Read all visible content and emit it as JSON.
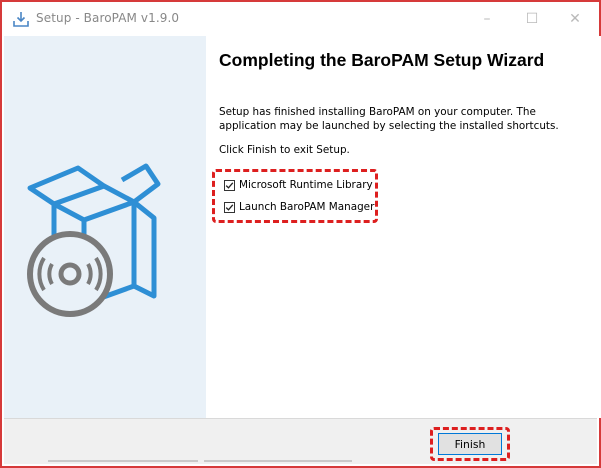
{
  "window": {
    "title": "Setup - BaroPAM v1.9.0",
    "icon": "setup-download-icon",
    "controls": {
      "minimize": "–",
      "maximize": "☐",
      "close": "✕"
    }
  },
  "wizard": {
    "heading": "Completing the BaroPAM Setup Wizard",
    "description": "Setup has finished installing BaroPAM on your computer. The application may be launched by selecting the installed shortcuts.",
    "instruction": "Click Finish to exit Setup.",
    "options": [
      {
        "label": "Microsoft Runtime Library",
        "checked": true
      },
      {
        "label": "Launch BaroPAM Manager",
        "checked": true
      }
    ]
  },
  "footer": {
    "finish_label": "Finish"
  },
  "colors": {
    "highlight": "#dd1f1f",
    "accent": "#2e8fd5",
    "side_panel": "#e9f1f8"
  }
}
